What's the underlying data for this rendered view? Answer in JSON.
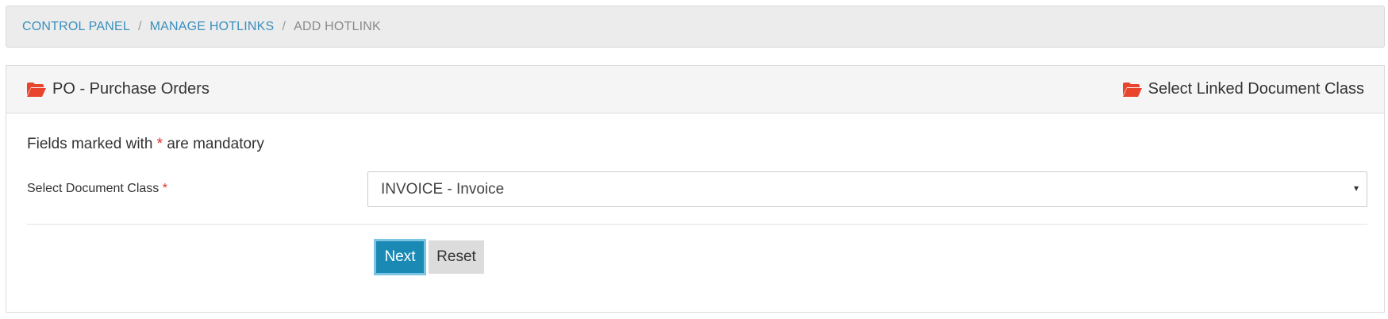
{
  "breadcrumb": {
    "items": [
      {
        "label": "CONTROL PANEL"
      },
      {
        "label": "MANAGE HOTLINKS"
      }
    ],
    "current": "ADD HOTLINK",
    "separator": "/"
  },
  "panel": {
    "title": "PO - Purchase Orders",
    "right_title": "Select Linked Document Class",
    "icon": "folder-open-icon",
    "icon_color": "#e8452c"
  },
  "form": {
    "note_prefix": "Fields marked with",
    "note_star": "*",
    "note_suffix": "are mandatory",
    "doc_class_label": "Select Document Class",
    "required_star": "*",
    "doc_class_value": "INVOICE - Invoice",
    "caret": "▾"
  },
  "buttons": {
    "next": "Next",
    "reset": "Reset"
  },
  "colors": {
    "link": "#3b8fbd",
    "primary": "#1a8ab5",
    "required": "#e02b2b"
  }
}
